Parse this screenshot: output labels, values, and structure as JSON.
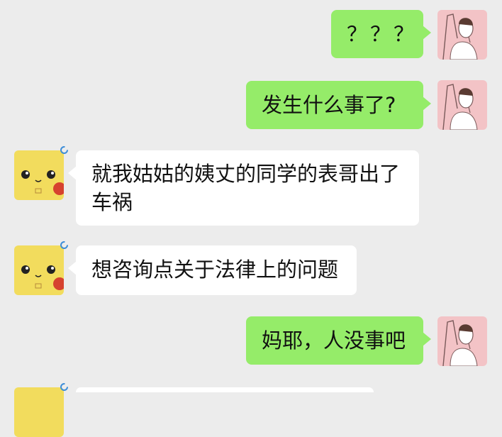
{
  "conversation": {
    "messages": [
      {
        "side": "out",
        "text": "？？？"
      },
      {
        "side": "out",
        "text": "发生什么事了?"
      },
      {
        "side": "in",
        "line1": "就我姑姑的姨丈的同学的表哥出了",
        "line2": "车祸"
      },
      {
        "side": "in",
        "text": "想咨询点关于法律上的问题"
      },
      {
        "side": "out",
        "text": "妈耶，人没事吧"
      },
      {
        "side": "in",
        "text": ""
      }
    ]
  },
  "icons": {
    "self_avatar": "woman-sketch-avatar",
    "contact_avatar": "pikachu-avatar",
    "status": "loading-ring-icon"
  },
  "colors": {
    "background": "#ececec",
    "outgoing_bubble": "#95ec69",
    "incoming_bubble": "#ffffff",
    "self_avatar_bg": "#f3c3c6",
    "contact_avatar_bg": "#f2dc5d",
    "status_ring": "#3c8dd8"
  }
}
